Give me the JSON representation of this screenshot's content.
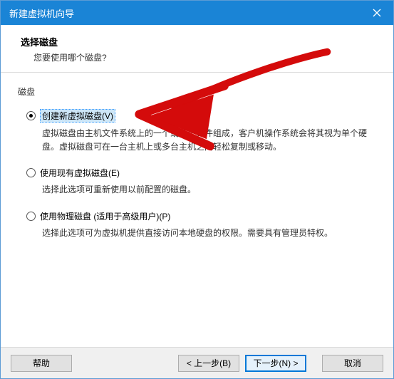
{
  "window": {
    "title": "新建虚拟机向导"
  },
  "header": {
    "title": "选择磁盘",
    "subtitle": "您要使用哪个磁盘?"
  },
  "group": {
    "label": "磁盘"
  },
  "options": [
    {
      "label": "创建新虚拟磁盘(V)",
      "desc": "虚拟磁盘由主机文件系统上的一个或多个文件组成，客户机操作系统会将其视为单个硬盘。虚拟磁盘可在一台主机上或多台主机之间轻松复制或移动。",
      "checked": true
    },
    {
      "label": "使用现有虚拟磁盘(E)",
      "desc": "选择此选项可重新使用以前配置的磁盘。",
      "checked": false
    },
    {
      "label": "使用物理磁盘 (适用于高级用户)(P)",
      "desc": "选择此选项可为虚拟机提供直接访问本地硬盘的权限。需要具有管理员特权。",
      "checked": false
    }
  ],
  "buttons": {
    "help": "帮助",
    "back": "< 上一步(B)",
    "next": "下一步(N) >",
    "cancel": "取消"
  },
  "colors": {
    "accent": "#1a84d6",
    "annotation": "#d40b0b"
  }
}
